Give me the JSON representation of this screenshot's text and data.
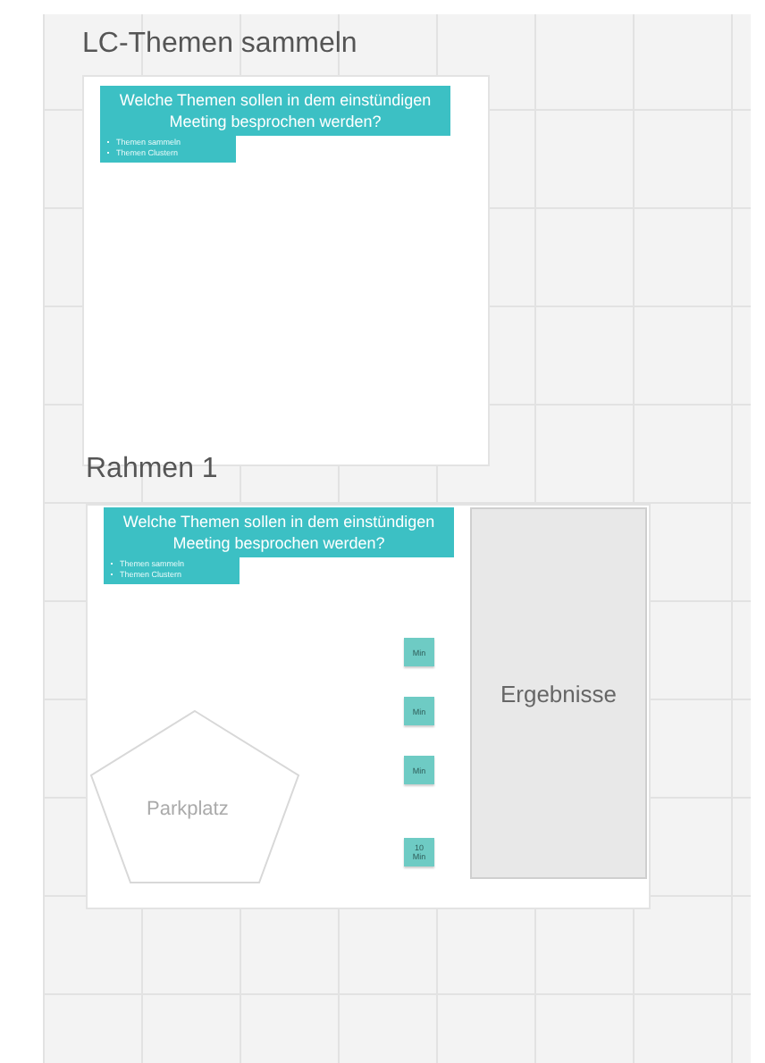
{
  "frames": [
    {
      "title": "LC-Themen sammeln",
      "question": "Welche Themen sollen in dem einstündigen Meeting besprochen werden?",
      "bullets": [
        "Themen sammeln",
        "Themen Clustern"
      ]
    },
    {
      "title": "Rahmen 1",
      "question": "Welche Themen sollen in dem einstündigen Meeting besprochen werden?",
      "bullets": [
        "Themen sammeln",
        "Themen Clustern"
      ],
      "stickies": [
        "Min",
        "Min",
        "Min",
        "10 Min"
      ],
      "results_label": "Ergebnisse",
      "parking_label": "Parkplatz"
    }
  ]
}
